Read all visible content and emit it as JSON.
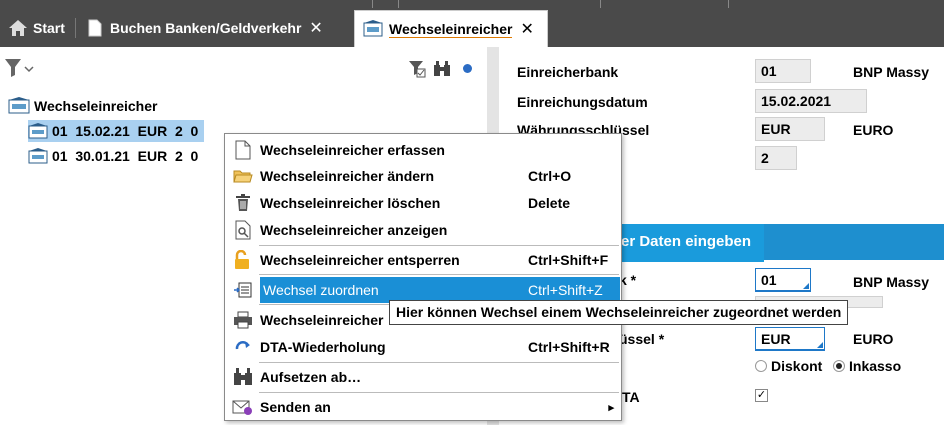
{
  "tabs": [
    {
      "label": "Start"
    },
    {
      "label": "Buchen Banken/Geldverkehr",
      "close": "✕"
    },
    {
      "label": "Wechseleinreicher",
      "close": "✕"
    }
  ],
  "tree": {
    "root": "Wechseleinreicher",
    "rows": [
      {
        "text": "01  15.02.21  EUR  2  0"
      },
      {
        "text": "01  30.01.21  EUR  2  0"
      }
    ]
  },
  "form": {
    "einreicherbank_label": "Einreicherbank",
    "einreicherbank_value": "01",
    "einreicherbank_name": "BNP Massy",
    "datum_label": "Einreichungsdatum",
    "datum_value": "15.02.2021",
    "waehrung_label": "Währungsschlüssel",
    "waehrung_value": "EUR",
    "waehrung_name": "EURO",
    "count_value": "2",
    "edit_tab_label": "er Daten eingeben",
    "bank_label_partial": "k *",
    "bank_input": "01",
    "bank_input_name": "BNP Massy",
    "waehrung_label_partial": "üssel *",
    "waehrung_input": "EUR",
    "waehrung_input_name": "EURO",
    "radio_diskont": "Diskont",
    "radio_inkasso": "Inkasso",
    "dta_label_partial": "TA",
    "dta_check": "✓"
  },
  "menu": {
    "items": [
      {
        "label": "Wechseleinreicher erfassen",
        "shortcut": "",
        "icon": "document-icon"
      },
      {
        "label": "Wechseleinreicher ändern",
        "shortcut": "Ctrl+O",
        "icon": "folder-open-icon"
      },
      {
        "label": "Wechseleinreicher löschen",
        "shortcut": "Delete",
        "icon": "trash-icon"
      },
      {
        "label": "Wechseleinreicher anzeigen",
        "shortcut": "",
        "icon": "view-document-icon"
      },
      {
        "label": "Wechseleinreicher entsperren",
        "shortcut": "Ctrl+Shift+F",
        "icon": "unlock-icon"
      },
      {
        "label": "Wechsel zuordnen",
        "shortcut": "Ctrl+Shift+Z",
        "icon": "assign-icon"
      },
      {
        "label": "Wechseleinreicher",
        "shortcut": "",
        "icon": "print-icon"
      },
      {
        "label": "DTA-Wiederholung",
        "shortcut": "Ctrl+Shift+R",
        "icon": "refresh-icon"
      },
      {
        "label": "Aufsetzen ab…",
        "shortcut": "",
        "icon": "binoculars-icon"
      },
      {
        "label": "Senden an",
        "shortcut": "",
        "icon": "send-icon",
        "submenu": "▸"
      }
    ]
  },
  "tooltip": "Hier können Wechsel einem Wechseleinreicher zugeordnet werden",
  "colors": {
    "tabbar": "#4a4a4a",
    "selection": "#a9d0f0",
    "menu_highlight": "#1a8fd6",
    "accent_blue": "#1e8fcf"
  }
}
